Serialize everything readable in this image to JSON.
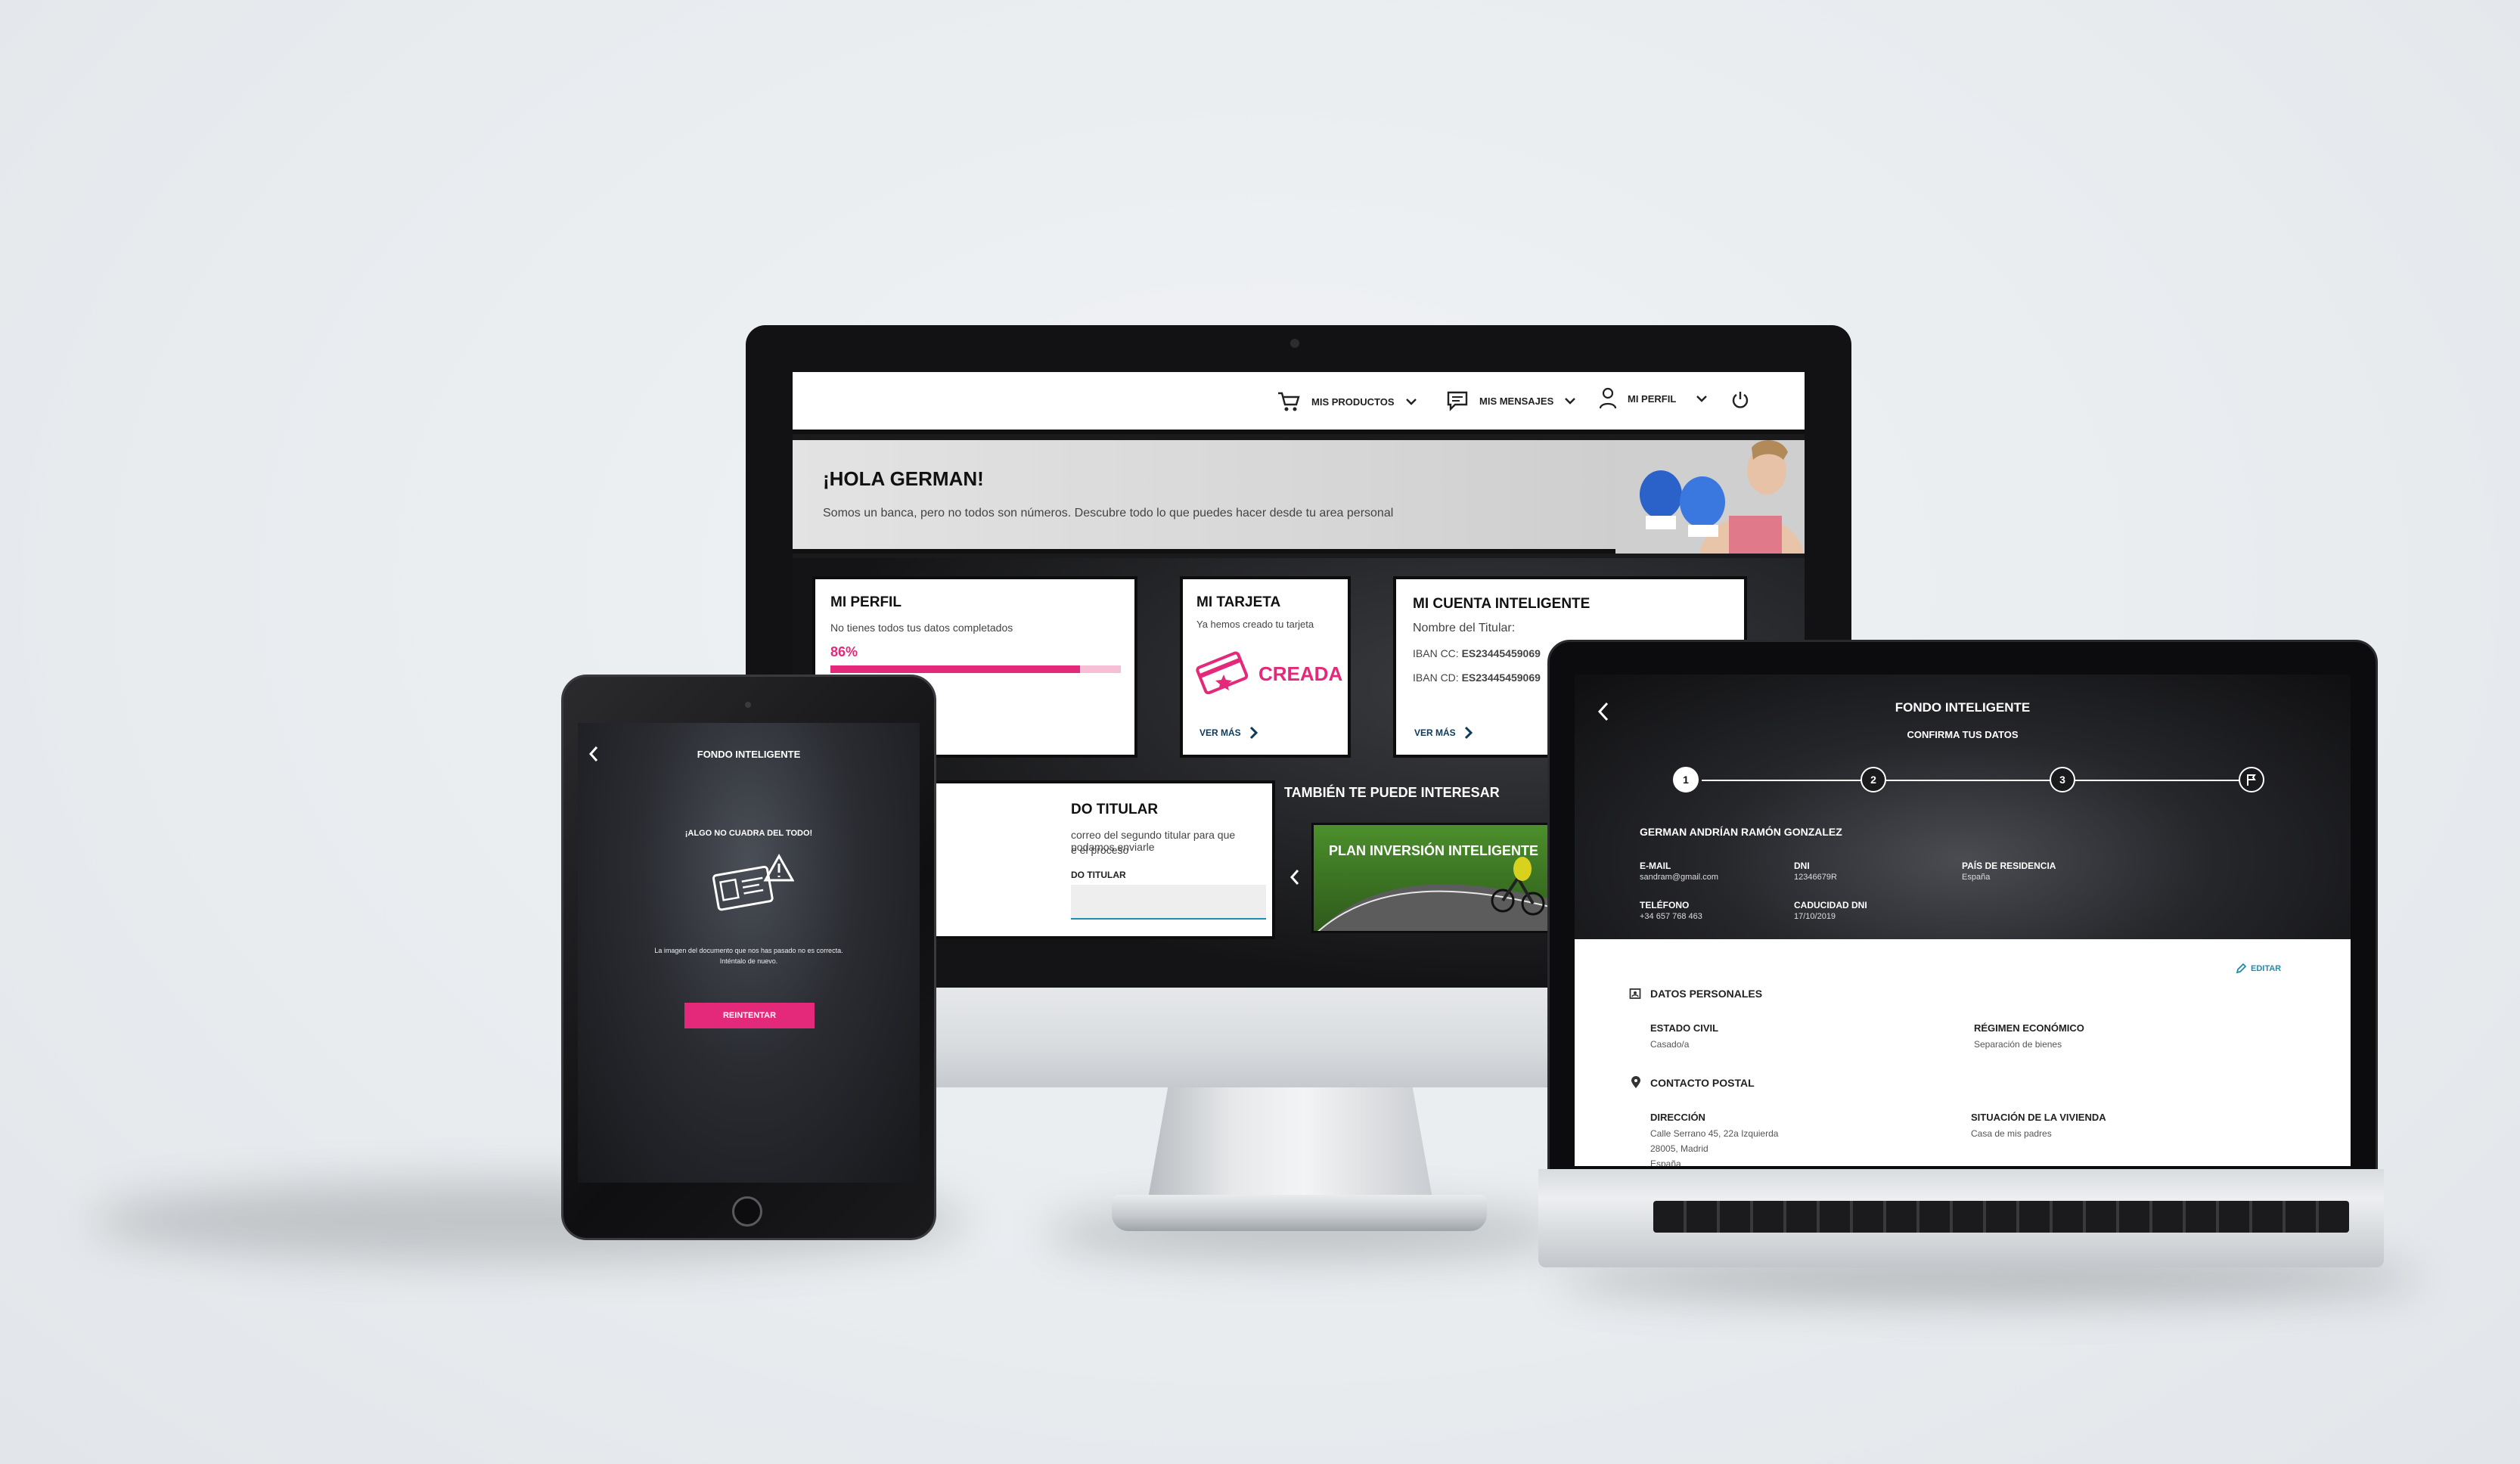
{
  "imac": {
    "nav": {
      "products": "MIS PRODUCTOS",
      "messages": "MIS MENSAJES",
      "profile": "MI PERFIL"
    },
    "hero": {
      "title": "¡HOLA GERMAN!",
      "subtitle": "Somos un banca, pero no todos son números. Descubre todo lo que puedes hacer desde tu area personal"
    },
    "profile_card": {
      "title": "MI PERFIL",
      "text": "No tienes todos tus datos completados",
      "percent_label": "86%",
      "progress": 0.86
    },
    "card_card": {
      "title": "MI TARJETA",
      "text": "Ya hemos creado tu tarjeta",
      "status": "CREADA",
      "more": "VER MÁS"
    },
    "account_card": {
      "title": "MI CUENTA INTELIGENTE",
      "holder_label": "Nombre del Titular:",
      "iban_cc_label": "IBAN CC:",
      "iban_cc_value": "ES23445459069",
      "iban_cd_label": "IBAN CD:",
      "iban_cd_value": "ES23445459069",
      "more": "VER MÁS"
    },
    "second_holder": {
      "title": "DO TITULAR",
      "text_line1": "correo del segundo titular para que podamos enviarle",
      "text_line2": "e el proceso",
      "field_label": "DO TITULAR"
    },
    "interest": {
      "title": "TAMBIÉN TE PUEDE INTERESAR",
      "promo": "PLAN INVERSIÓN INTELIGENTE"
    }
  },
  "ipad": {
    "title": "FONDO INTELIGENTE",
    "alert": "¡ALGO NO CUADRA DEL TODO!",
    "message_line1": "La imagen del documento que nos has pasado no es correcta.",
    "message_line2": "Inténtalo de nuevo.",
    "retry": "REINTENTAR"
  },
  "laptop": {
    "title": "FONDO INTELIGENTE",
    "subtitle": "CONFIRMA TUS DATOS",
    "steps": [
      "1",
      "2",
      "3"
    ],
    "name": "GERMAN ANDRÍAN RAMÓN GONZALEZ",
    "email_label": "E-MAIL",
    "email_value": "sandram@gmail.com",
    "dni_label": "DNI",
    "dni_value": "12346679R",
    "country_label": "PAÍS DE RESIDENCIA",
    "country_value": "España",
    "phone_label": "TELÉFONO",
    "phone_value": "+34 657 768 463",
    "dni_exp_label": "CADUCIDAD DNI",
    "dni_exp_value": "17/10/2019",
    "edit": "EDITAR",
    "personal_section": "DATOS PERSONALES",
    "civil_label": "ESTADO CIVIL",
    "civil_value": "Casado/a",
    "regime_label": "RÉGIMEN ECONÓMICO",
    "regime_value": "Separación de bienes",
    "postal_section": "CONTACTO POSTAL",
    "address_label": "DIRECCIÓN",
    "address_line1": "Calle Serrano 45, 22a Izquierda",
    "address_line2": "28005, Madrid",
    "address_line3": "España",
    "housing_label": "SITUACIÓN DE LA VIVIENDA",
    "housing_value": "Casa de mis padres"
  },
  "colors": {
    "accent": "#e5297a",
    "link": "#0e3a5a",
    "edit": "#1a8fb0"
  }
}
